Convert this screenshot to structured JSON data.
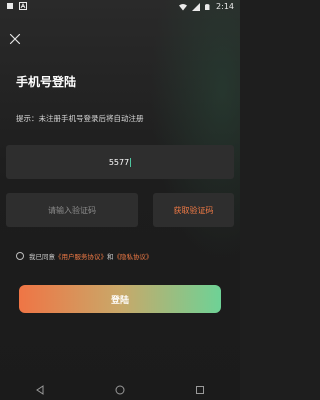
{
  "status_bar": {
    "time": "2:14",
    "icons": [
      "notification-square-icon",
      "notification-a-icon",
      "wifi-icon",
      "signal-icon",
      "battery-icon"
    ]
  },
  "header": {
    "close_icon": "close-icon",
    "title": "手机号登陆",
    "hint": "提示：未注册手机号登录后将自动注册"
  },
  "form": {
    "phone_value": "5577",
    "code_placeholder": "请输入验证码",
    "get_code_label": "获取验证码"
  },
  "agreement": {
    "prefix": "我已同意",
    "user_agreement": "《用户服务协议》",
    "conjunction": "和",
    "privacy_policy": "《隐私协议》"
  },
  "login_button": {
    "label": "登陆"
  },
  "colors": {
    "accent": "#f07a45",
    "gradient_start": "#ef7545",
    "gradient_end": "#6ed296",
    "field_bg": "#2e2e2e"
  },
  "nav_bar": {
    "icons": [
      "back-icon",
      "home-icon",
      "recents-icon"
    ]
  }
}
